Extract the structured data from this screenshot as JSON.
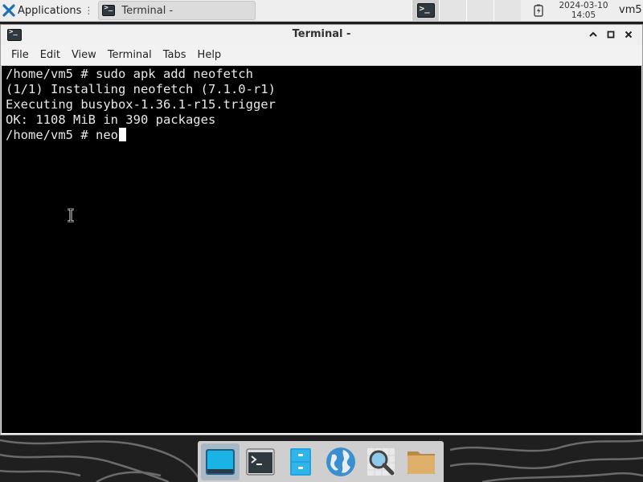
{
  "top_panel": {
    "applications_label": "Applications",
    "applications_separator": "⋮",
    "taskbar_window_title": "Terminal -",
    "clock_date": "2024-03-10",
    "clock_time": "14:05",
    "user": "vm5"
  },
  "window": {
    "title": "Terminal -",
    "controls": {
      "maximize": "⌃",
      "minimize": "▫",
      "close": "✕"
    },
    "menu": [
      "File",
      "Edit",
      "View",
      "Terminal",
      "Tabs",
      "Help"
    ]
  },
  "terminal": {
    "lines": [
      "/home/vm5 # sudo apk add neofetch",
      "(1/1) Installing neofetch (7.1.0-r1)",
      "Executing busybox-1.36.1-r15.trigger",
      "OK: 1108 MiB in 390 packages"
    ],
    "prompt_line": "/home/vm5 # neo"
  },
  "dock": {
    "items": [
      {
        "name": "show-desktop",
        "icon": "desktop-icon"
      },
      {
        "name": "terminal",
        "icon": "terminal-icon"
      },
      {
        "name": "file-cabinet",
        "icon": "file-cabinet-icon"
      },
      {
        "name": "web-browser",
        "icon": "globe-icon"
      },
      {
        "name": "app-finder",
        "icon": "magnifier-icon"
      },
      {
        "name": "file-manager",
        "icon": "folder-icon"
      }
    ]
  },
  "colors": {
    "terminal_bg": "#000000",
    "terminal_fg": "#e8e8e8",
    "panel_bg": "#eeeeee",
    "dock_bg": "#cfcfcf"
  }
}
